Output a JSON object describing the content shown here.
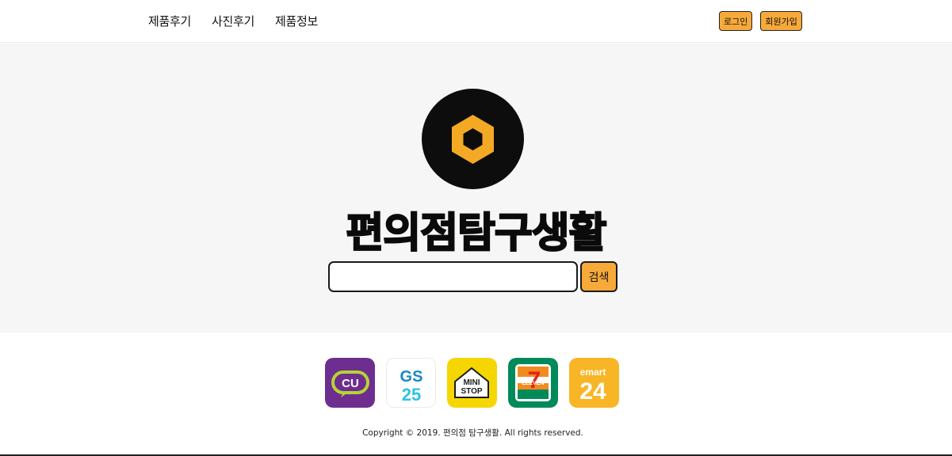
{
  "header": {
    "nav": [
      "제품후기",
      "사진후기",
      "제품정보"
    ],
    "login_label": "로그인",
    "signup_label": "회원가입"
  },
  "hero": {
    "logo_icon": "hexagon-logo-icon",
    "title": "편의점탐구생활",
    "search_value": "",
    "search_button_label": "검색"
  },
  "brands": [
    {
      "name": "CU",
      "label": "CU",
      "bg": "#6e2e8f"
    },
    {
      "name": "GS25",
      "label_top": "GS",
      "label_bottom": "25",
      "bg": "#ffffff"
    },
    {
      "name": "MINISTOP",
      "label_top": "MINI",
      "label_bottom": "STOP",
      "bg": "#f6d600"
    },
    {
      "name": "7-ELEVEN",
      "label_big": "7",
      "label_small": "ELEVEN",
      "bg": "#008a5a"
    },
    {
      "name": "emart24",
      "label_top": "emart",
      "label_bottom": "24",
      "bg": "#f8b526"
    }
  ],
  "footer": {
    "copyright": "Copyright © 2019. 편의점 탐구생활. All rights reserved."
  },
  "colors": {
    "accent": "#f7a93a",
    "hero_bg": "#f6f6f6",
    "logo_bg": "#0d0d0d"
  }
}
